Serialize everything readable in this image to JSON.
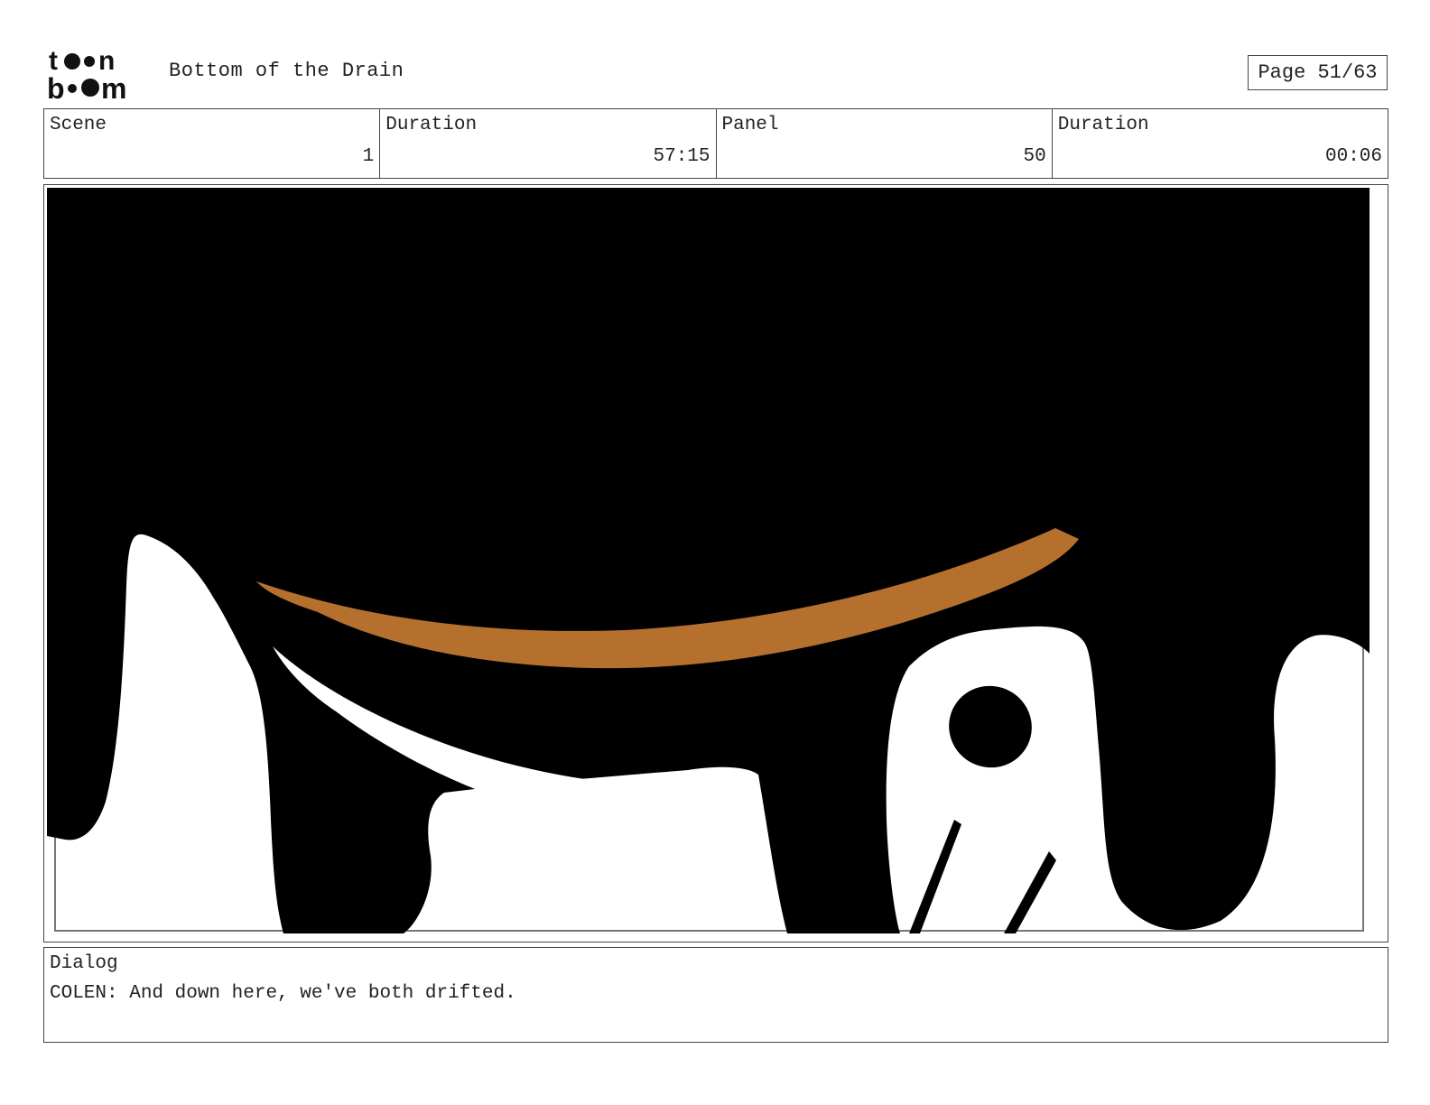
{
  "header": {
    "logo_text": "toon boom",
    "title": "Bottom of the Drain",
    "page": "Page 51/63"
  },
  "info": {
    "scene_label": "Scene",
    "scene_value": "1",
    "scene_duration_label": "Duration",
    "scene_duration_value": "57:15",
    "panel_label": "Panel",
    "panel_value": "50",
    "panel_duration_label": "Duration",
    "panel_duration_value": "00:06"
  },
  "dialog": {
    "label": "Dialog",
    "text": "COLEN: And down here, we've both drifted."
  },
  "colors": {
    "ink": "#000000",
    "paper": "#ffffff",
    "accent": "#b5702e",
    "border": "#444444"
  }
}
